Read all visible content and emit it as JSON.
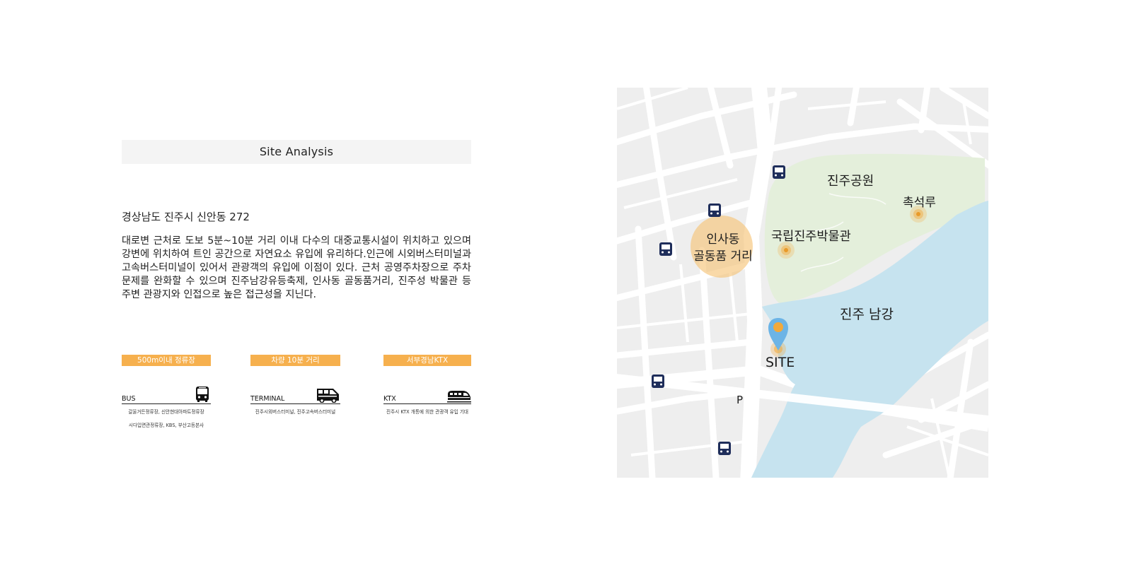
{
  "header": {
    "title": "Site Analysis"
  },
  "info": {
    "address": "경상남도 진주시 신안동 272",
    "description": "대로변 근처로 도보 5분~10분 거리 이내 다수의 대중교통시설이 위치하고 있으며 강변에 위치하여 트인 공간으로 자연요소 유입에 유리하다.인근에 시외버스터미널과 고속버스터미널이 있어서 관광객의 유입에 이점이 있다. 근처 공영주차장으로 주차문제를 완화할 수 있으며 진주남강유등축제, 인사동 골동품거리, 진주성 박물관 등 주변 관광지와 인접으로 높은 접근성을 지닌다."
  },
  "transport": [
    {
      "tag": "500m이내 정류장",
      "label": "BUS",
      "icon": "bus-icon",
      "notes": [
        "갈울거든정류장, 신안현대아파트정류장",
        "시다입면관정류장, KBS, 부산고등본사"
      ]
    },
    {
      "tag": "차량 10분 거리",
      "label": "TERMINAL",
      "icon": "terminal-bus-icon",
      "notes": [
        "진주시외버스터미널, 진주고속버스터미널"
      ]
    },
    {
      "tag": "서부경남KTX",
      "label": "KTX",
      "icon": "train-icon",
      "notes": [
        "진주시 KTX 개통에 의한 관광객 유입 기대"
      ]
    }
  ],
  "map": {
    "labels": {
      "park": "진주공원",
      "pavilion": "촉석루",
      "museum": "국립진주박물관",
      "street_line1": "인사동",
      "street_line2": "골동품 거리",
      "river": "진주 남강",
      "site": "SITE",
      "parking": "P"
    },
    "colors": {
      "water": "#c6e3ef",
      "park": "#e4efdb",
      "highlight": "#f6c47a",
      "pin": "#6cb4e6",
      "accent": "#f2a93b",
      "bus": "#1e2d5a"
    },
    "icons": [
      "bus-stop-icon",
      "map-pin-icon",
      "landmark-marker-icon"
    ]
  }
}
